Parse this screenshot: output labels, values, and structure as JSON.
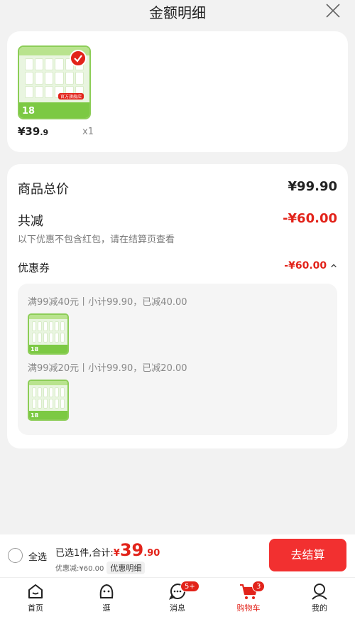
{
  "header": {
    "title": "金额明细",
    "close_icon": "close-icon"
  },
  "product": {
    "num_label": "18",
    "tag": "官方旗舰店",
    "price_int": "¥39",
    "price_dec": ".9",
    "qty": "x1"
  },
  "summary": {
    "total_label": "商品总价",
    "total_value": "¥99.90",
    "reduce_label": "共减",
    "reduce_value": "-¥60.00",
    "note": "以下优惠不包含红包，请在结算页查看",
    "coupon_label": "优惠券",
    "coupon_value": "-¥60.00",
    "coupons": [
      {
        "text": "满99减40元丨小计99.90，已减40.00"
      },
      {
        "text": "满99减20元丨小计99.90，已减20.00"
      }
    ]
  },
  "bottom": {
    "select_all": "全选",
    "selected_text": "已选1件,合计:",
    "currency": "¥",
    "price_int": "39",
    "price_dec": ".90",
    "discount_text": "优惠减:¥60.00",
    "detail_btn": "优惠明细",
    "checkout": "去结算"
  },
  "tabs": [
    {
      "label": "首页",
      "icon": "home-icon"
    },
    {
      "label": "逛",
      "icon": "explore-face-icon"
    },
    {
      "label": "消息",
      "icon": "message-icon",
      "badge": "5+"
    },
    {
      "label": "购物车",
      "icon": "cart-icon",
      "badge": "3",
      "active": true
    },
    {
      "label": "我的",
      "icon": "profile-icon"
    }
  ],
  "colors": {
    "accent": "#e2231a",
    "button": "#f23030",
    "green": "#8ccd57"
  }
}
